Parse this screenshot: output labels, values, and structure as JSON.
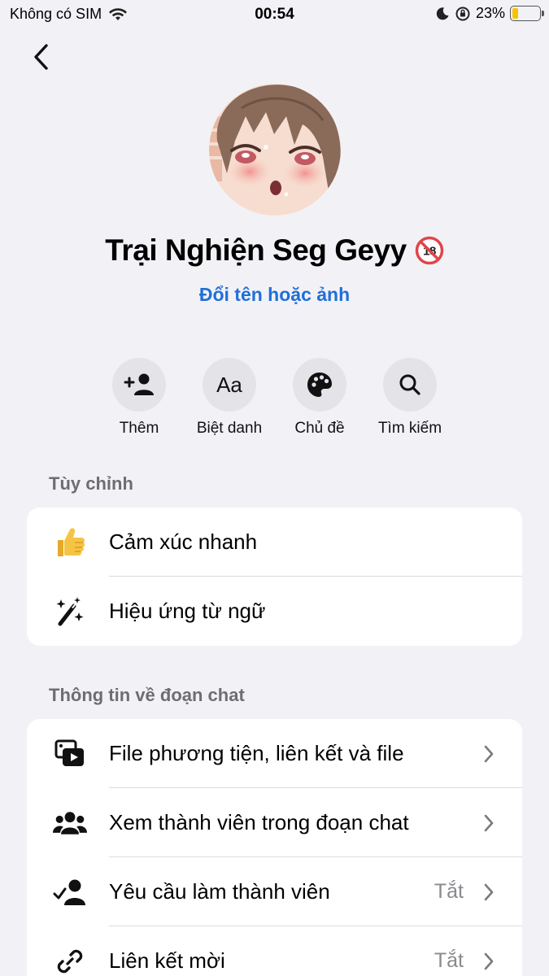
{
  "status_bar": {
    "carrier": "Không có SIM",
    "time": "00:54",
    "battery": "23%",
    "battery_level": 0.23
  },
  "header": {
    "group_name": "Trại Nghiện Seg Geyy",
    "rename_link": "Đổi tên hoặc ảnh"
  },
  "actions": [
    {
      "label": "Thêm",
      "icon": "add-person-icon"
    },
    {
      "label": "Biệt danh",
      "icon": "nickname-aa-icon"
    },
    {
      "label": "Chủ đề",
      "icon": "palette-icon"
    },
    {
      "label": "Tìm kiếm",
      "icon": "search-icon"
    }
  ],
  "customize": {
    "title": "Tùy chỉnh",
    "rows": [
      {
        "label": "Cảm xúc nhanh",
        "icon": "thumbs-up-icon"
      },
      {
        "label": "Hiệu ứng từ ngữ",
        "icon": "magic-wand-icon"
      }
    ]
  },
  "chat_info": {
    "title": "Thông tin về đoạn chat",
    "rows": [
      {
        "label": "File phương tiện, liên kết và file",
        "icon": "media-files-icon",
        "value": ""
      },
      {
        "label": "Xem thành viên trong đoạn chat",
        "icon": "members-icon",
        "value": ""
      },
      {
        "label": "Yêu cầu làm thành viên",
        "icon": "member-request-icon",
        "value": "Tắt"
      },
      {
        "label": "Liên kết mời",
        "icon": "link-icon",
        "value": "Tắt"
      }
    ]
  },
  "colors": {
    "link_blue": "#1f6fd9",
    "background": "#f2f2f6",
    "battery_yellow": "#f4c400"
  }
}
